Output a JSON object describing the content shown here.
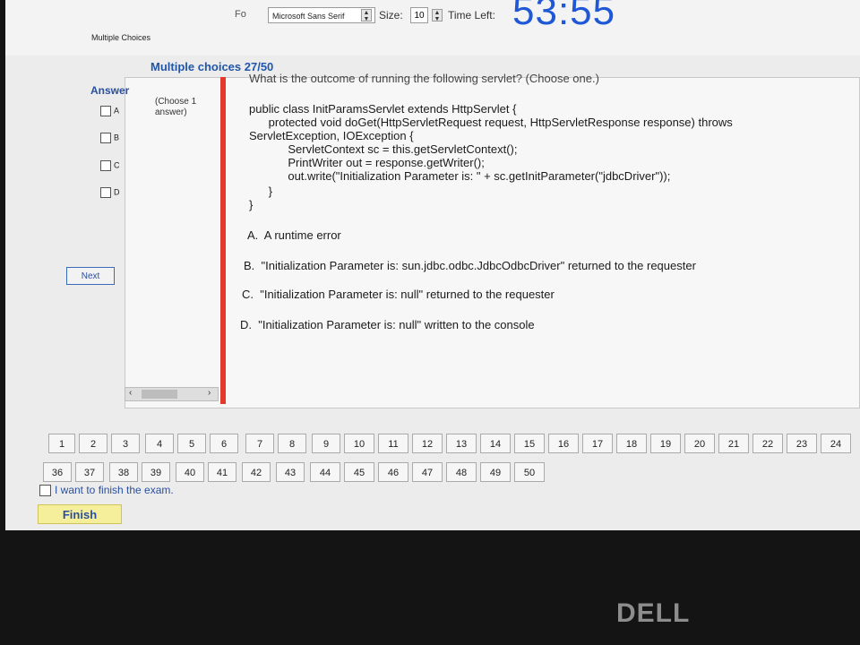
{
  "toolbar": {
    "font_label": "Fo",
    "font_name": "Microsoft Sans Serif",
    "size_label": "Size:",
    "size_value": "10",
    "time_label": "Time Left:",
    "time_value": "53:55"
  },
  "section_tab": "Multiple Choices",
  "question_header": "Multiple choices 27/50",
  "answer": {
    "title": "Answer",
    "options": [
      "A",
      "B",
      "C",
      "D"
    ],
    "hint": "(Choose 1 answer)",
    "next_label": "Next"
  },
  "question": {
    "lines": [
      "What is the outcome of running the following servlet? (Choose one.)",
      "public class InitParamsServlet extends HttpServlet {",
      "      protected void doGet(HttpServletRequest request, HttpServletResponse response) throws",
      "ServletException, IOException {",
      "            ServletContext sc = this.getServletContext();",
      "            PrintWriter out = response.getWriter();",
      "            out.write(\"Initialization Parameter is: \" + sc.getInitParameter(\"jdbcDriver\"));",
      "      }",
      "}",
      "A.  A runtime error",
      "B.  \"Initialization Parameter is: sun.jdbc.odbc.JdbcOdbcDriver\" returned to the requester",
      "C.  \"Initialization Parameter is: null\" returned to the requester",
      "D.  \"Initialization Parameter is: null\" written to the console"
    ]
  },
  "question_numbers": [
    "1",
    "2",
    "3",
    "4",
    "5",
    "6",
    "7",
    "8",
    "9",
    "10",
    "11",
    "12",
    "13",
    "14",
    "15",
    "16",
    "17",
    "18",
    "19",
    "20",
    "21",
    "22",
    "23",
    "24",
    "36",
    "37",
    "38",
    "39",
    "40",
    "41",
    "42",
    "43",
    "44",
    "45",
    "46",
    "47",
    "48",
    "49",
    "50"
  ],
  "finish": {
    "checkbox_label": "I want to finish the exam.",
    "button_label": "Finish"
  },
  "bezel_logo": "DELL",
  "colors": {
    "accent": "#2156a8",
    "timer": "#1f58d6",
    "divider": "#e23a2d",
    "finish_button": "#f5ef9c"
  }
}
